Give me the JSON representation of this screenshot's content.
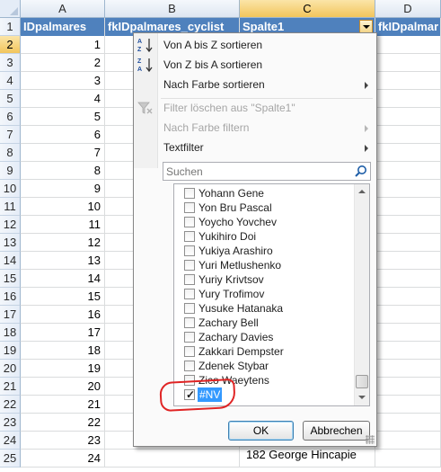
{
  "spreadsheet": {
    "columns": [
      "A",
      "B",
      "C",
      "D"
    ],
    "header_row": {
      "a": "IDpalmares",
      "b": "fkIDpalmares_cyclist",
      "c": "Spalte1",
      "d": "fkIDpalmar"
    },
    "row_numbers": [
      "1",
      "2",
      "3",
      "4",
      "5",
      "6",
      "7",
      "8",
      "9",
      "10",
      "11",
      "12",
      "13",
      "14",
      "15",
      "16",
      "17",
      "18",
      "19",
      "20",
      "21",
      "22",
      "23",
      "24",
      "25"
    ],
    "id_values": [
      "1",
      "2",
      "3",
      "4",
      "5",
      "6",
      "7",
      "8",
      "9",
      "10",
      "11",
      "12",
      "13",
      "14",
      "15",
      "16",
      "17",
      "18",
      "19",
      "20",
      "21",
      "22",
      "23",
      "24"
    ],
    "row25_text": "182 George Hincapie"
  },
  "filter_menu": {
    "sort_az": "Von A bis Z sortieren",
    "sort_za": "Von Z bis A sortieren",
    "sort_by_color": "Nach Farbe sortieren",
    "clear_filter": "Filter löschen aus \"Spalte1\"",
    "filter_by_color": "Nach Farbe filtern",
    "text_filter": "Textfilter",
    "search_placeholder": "Suchen",
    "items": [
      {
        "label": "Yohann Gene",
        "checked": false
      },
      {
        "label": "Yon Bru Pascal",
        "checked": false
      },
      {
        "label": "Yoycho Yovchev",
        "checked": false
      },
      {
        "label": "Yukihiro Doi",
        "checked": false
      },
      {
        "label": "Yukiya Arashiro",
        "checked": false
      },
      {
        "label": "Yuri Metlushenko",
        "checked": false
      },
      {
        "label": "Yuriy Krivtsov",
        "checked": false
      },
      {
        "label": "Yury Trofimov",
        "checked": false
      },
      {
        "label": "Yusuke Hatanaka",
        "checked": false
      },
      {
        "label": "Zachary Bell",
        "checked": false
      },
      {
        "label": "Zachary Davies",
        "checked": false
      },
      {
        "label": "Zakkari Dempster",
        "checked": false
      },
      {
        "label": "Zdenek Stybar",
        "checked": false
      },
      {
        "label": "Zico Waeytens",
        "checked": false
      },
      {
        "label": "#NV",
        "checked": true
      }
    ],
    "ok_label": "OK",
    "cancel_label": "Abbrechen"
  },
  "colors": {
    "table_header": "#4f81bd",
    "selection_highlight": "#f2c55c",
    "annotation_red": "#e02424",
    "list_highlight": "#3399ff"
  },
  "icons": [
    "sort-ascending-icon",
    "sort-descending-icon",
    "clear-filter-icon",
    "search-icon",
    "checkmark-icon",
    "chevron-right-icon"
  ]
}
